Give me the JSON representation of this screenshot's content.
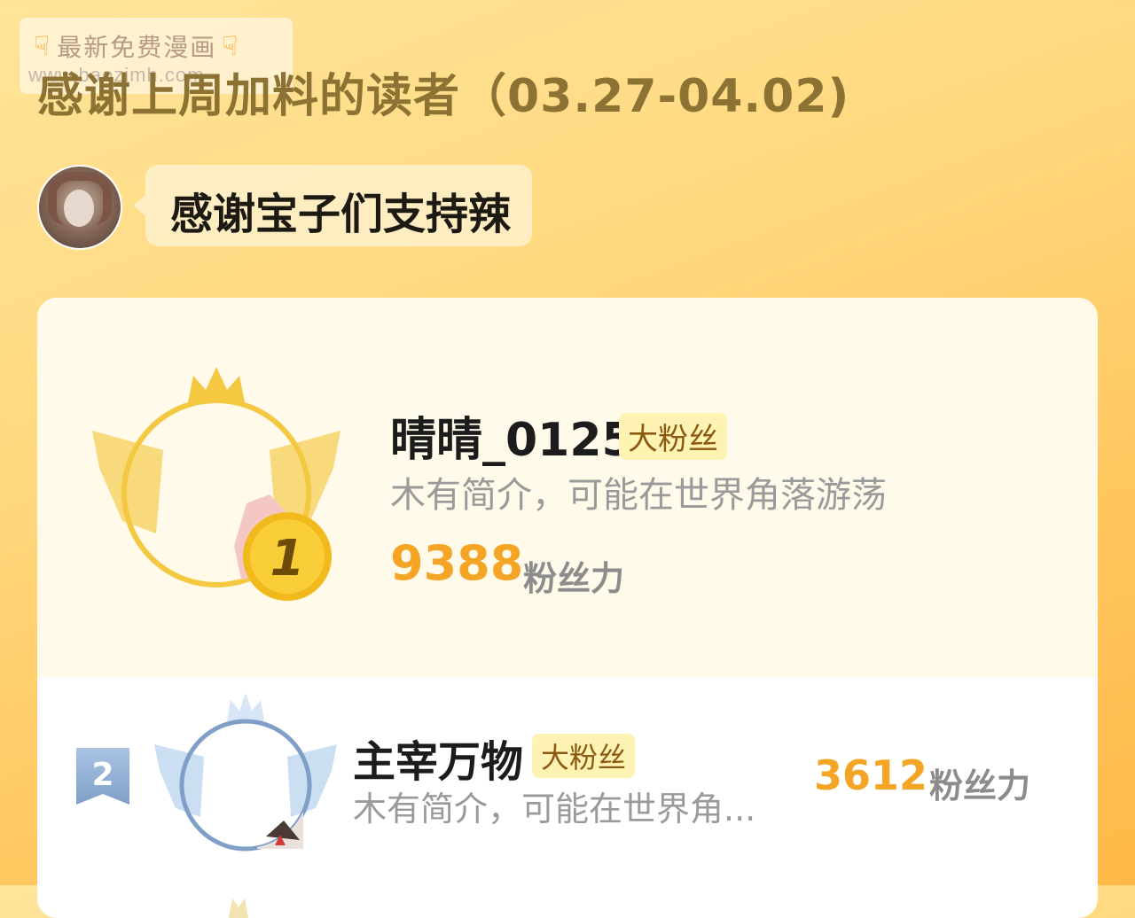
{
  "watermark": {
    "line1": "最新免费漫画",
    "line2": "www.baozimh.com"
  },
  "header": {
    "title": "感谢上周加料的读者（03.27-04.02)"
  },
  "author_message": {
    "text": "感谢宝子们支持辣"
  },
  "ranking": [
    {
      "rank": "1",
      "name": "晴晴_0125",
      "badge": "大粉丝",
      "bio": "木有简介，可能在世界角落游荡",
      "score": "9388",
      "unit": "粉丝力"
    },
    {
      "rank": "2",
      "name": "主宰万物",
      "badge": "大粉丝",
      "bio": "木有简介，可能在世界角...",
      "score": "3612",
      "unit": "粉丝力"
    }
  ],
  "colors": {
    "accent": "#f5a526",
    "badge_bg": "#fff3b3",
    "gold": "#f2c94c",
    "silver_blue": "#8aa7c9"
  }
}
